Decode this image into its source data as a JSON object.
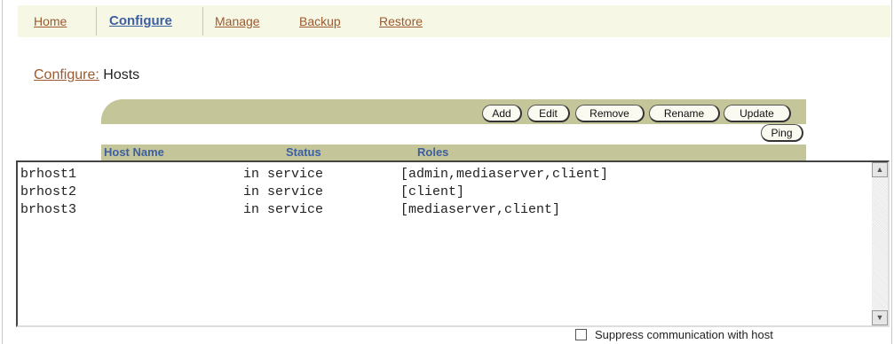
{
  "tabs": [
    {
      "label": "Home",
      "active": false
    },
    {
      "label": "Configure",
      "active": true
    },
    {
      "label": "Manage",
      "active": false
    },
    {
      "label": "Backup",
      "active": false
    },
    {
      "label": "Restore",
      "active": false
    }
  ],
  "breadcrumb": {
    "parent": "Configure:",
    "current": "Hosts"
  },
  "toolbar": {
    "add": "Add",
    "edit": "Edit",
    "remove": "Remove",
    "rename": "Rename",
    "update": "Update",
    "ping": "Ping"
  },
  "columns": {
    "host": "Host Name",
    "status": "Status",
    "roles": "Roles"
  },
  "rows": [
    {
      "host": "brhost1",
      "status": "in service",
      "roles": "[admin,mediaserver,client]"
    },
    {
      "host": "brhost2",
      "status": "in service",
      "roles": "[client]"
    },
    {
      "host": "brhost3",
      "status": "in service",
      "roles": "[mediaserver,client]"
    }
  ],
  "suppress": {
    "label": "Suppress communication with host",
    "checked": false
  },
  "colors": {
    "accent_band": "#c5c59a",
    "tab_bg": "#f7f7e6",
    "link": "#9c5a2e",
    "active_tab": "#3c5fa0"
  }
}
